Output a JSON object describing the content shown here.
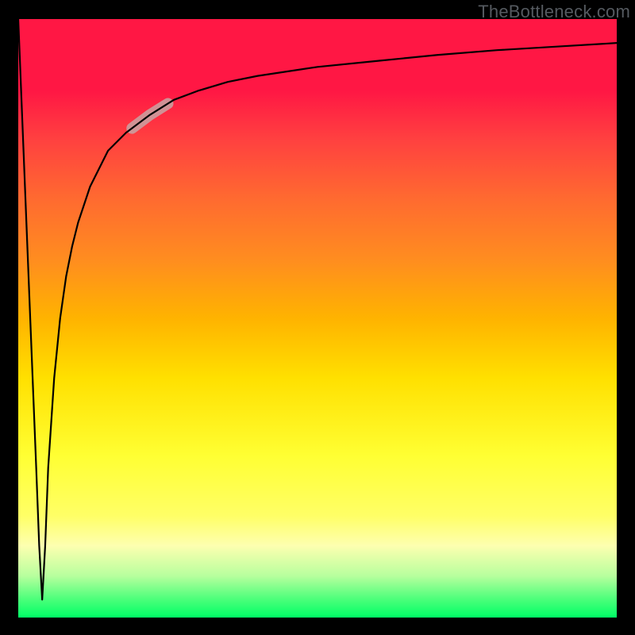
{
  "watermark": "TheBottleneck.com",
  "colors": {
    "frame": "#000000",
    "curve": "#000000",
    "highlight": "#caa0a0",
    "gradient_top": "#ff1744",
    "gradient_bottom": "#00ff66"
  },
  "chart_data": {
    "type": "line",
    "title": "",
    "xlabel": "",
    "ylabel": "",
    "xlim": [
      0,
      100
    ],
    "ylim": [
      0,
      100
    ],
    "notes": "Axes unlabeled. Background gradient from red (top) → green (bottom). Curve plunges from top-left to near-bottom at x≈4, then rises asymptotically toward y≈96 at right edge. A faint pink segment highlights x≈19–25.",
    "series": [
      {
        "name": "curve",
        "x": [
          0,
          1,
          2,
          3,
          3.5,
          4,
          4.5,
          5,
          6,
          7,
          8,
          9,
          10,
          12,
          15,
          18,
          22,
          26,
          30,
          35,
          40,
          50,
          60,
          70,
          80,
          90,
          100
        ],
        "y": [
          100,
          75,
          50,
          25,
          12,
          3,
          12,
          25,
          40,
          50,
          57,
          62,
          66,
          72,
          78,
          81,
          84,
          86.5,
          88,
          89.5,
          90.5,
          92,
          93,
          94,
          94.8,
          95.4,
          96
        ]
      }
    ],
    "highlight_range_x": [
      19,
      25
    ]
  }
}
